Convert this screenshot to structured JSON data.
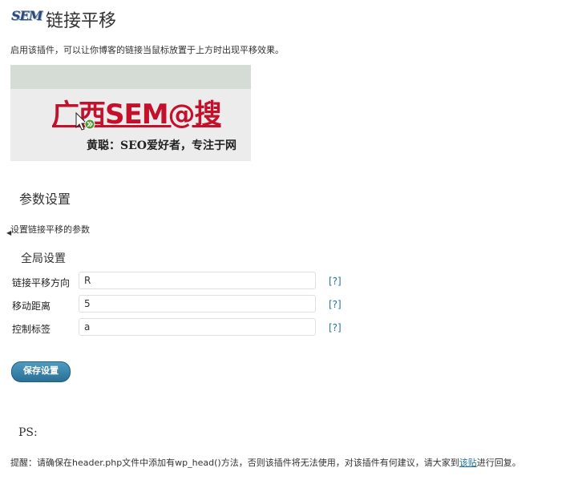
{
  "header": {
    "logo_text": "SEM",
    "title": "链接平移"
  },
  "intro": "启用该插件，可以让你博客的链接当鼠标放置于上方时出现平移效果。",
  "preview": {
    "headline": "广西SEM@搜",
    "subline": "黄聪：SEO爱好者，专注于网"
  },
  "params": {
    "title": "参数设置",
    "description": "设置链接平移的参数",
    "group_title": "全局设置",
    "fields": [
      {
        "label": "链接平移方向",
        "value": "R",
        "help": "[?]"
      },
      {
        "label": "移动距离",
        "value": "5",
        "help": "[?]"
      },
      {
        "label": "控制标签",
        "value": "a",
        "help": "[?]"
      }
    ]
  },
  "save_label": "保存设置",
  "ps": {
    "label": "PS:",
    "text_before": "提醒：请确保在header.php文件中添加有wp_head()方法，否则该插件将无法使用，对该插件有何建议，请大家到",
    "link": "该贴",
    "text_after": "进行回复。"
  },
  "colors": {
    "accent": "#21759b",
    "button": "#2a6f96",
    "headline": "#c4102a"
  }
}
